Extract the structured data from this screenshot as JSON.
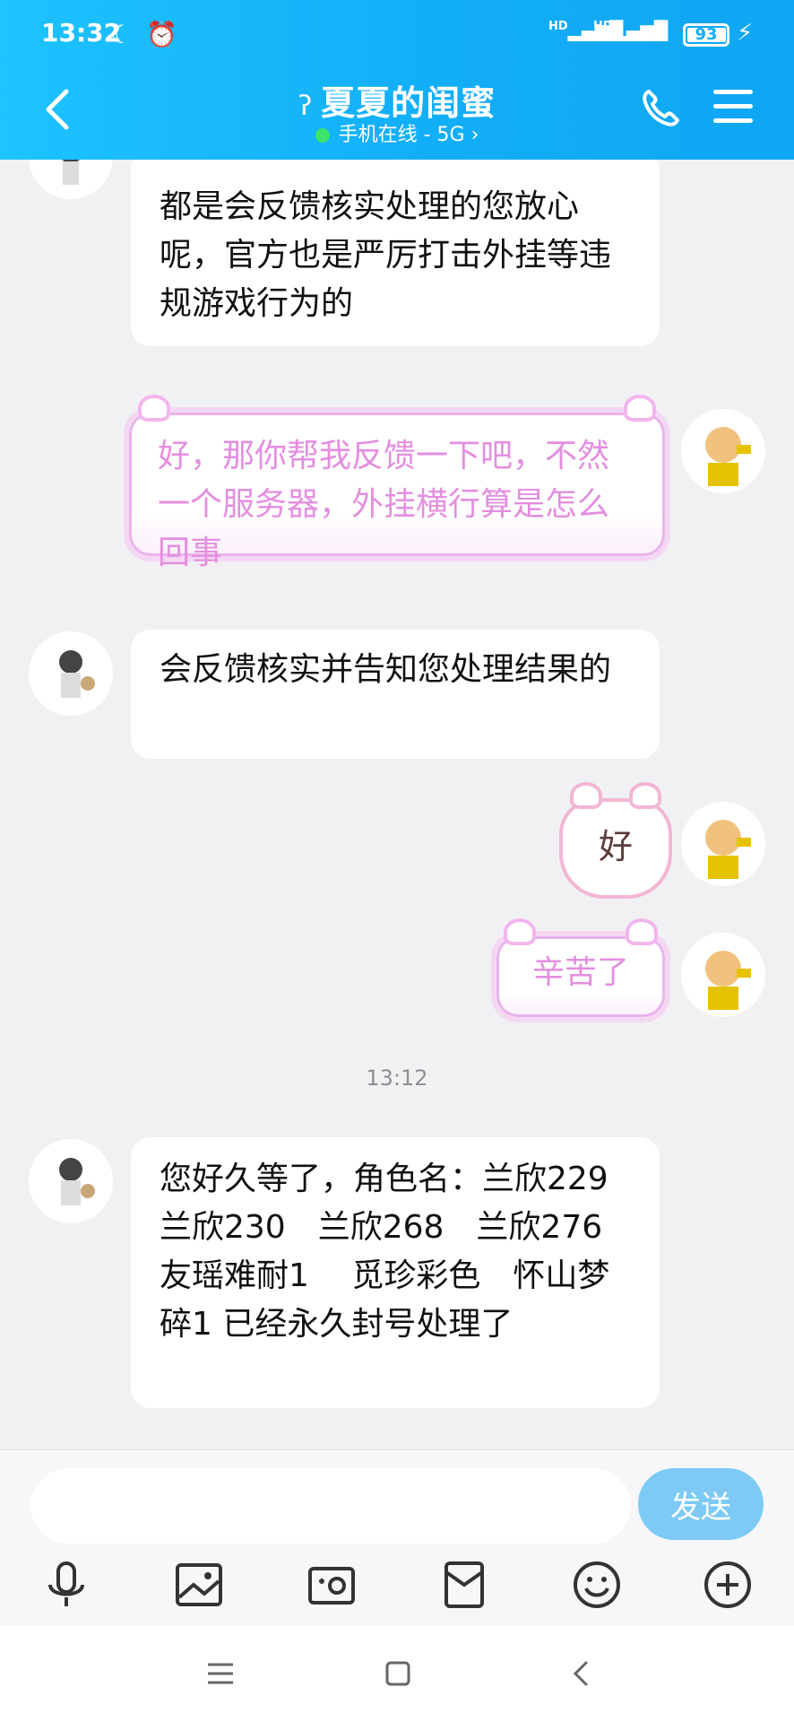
{
  "status_bar": {
    "time": "13:32",
    "signal_1_label": "HD",
    "signal_2_label": "HD",
    "battery": "93"
  },
  "header": {
    "title": "夏夏的闺蜜",
    "subtitle": "手机在线 - 5G",
    "online_color": "#3ee36a",
    "background": "#12aef7"
  },
  "messages": [
    {
      "side": "left",
      "text": "都是会反馈核实处理的您放心呢，官方也是严厉打击外挂等违规游戏行为的"
    },
    {
      "side": "right",
      "style": "cute",
      "text": "好，那你帮我反馈一下吧，不然一个服务器，外挂横行算是怎么回事"
    },
    {
      "side": "left",
      "text": "会反馈核实并告知您处理结果的"
    },
    {
      "side": "right",
      "style": "sticker",
      "text": "好"
    },
    {
      "side": "right",
      "style": "cute",
      "text": "辛苦了"
    },
    {
      "side": "left",
      "text": "您好久等了，角色名：兰欣229　兰欣230　兰欣268　兰欣276　 友瑶难耐1　 觅珍彩色　怀山梦碎1 已经永久封号处理了"
    }
  ],
  "timestamp": "13:12",
  "input": {
    "value": "",
    "send_label": "发送"
  },
  "toolbar_icons": [
    "microphone-icon",
    "image-icon",
    "camera-icon",
    "red-packet-icon",
    "emoji-icon",
    "plus-icon"
  ],
  "navbar_icons": [
    "menu-icon",
    "home-icon",
    "back-icon"
  ]
}
